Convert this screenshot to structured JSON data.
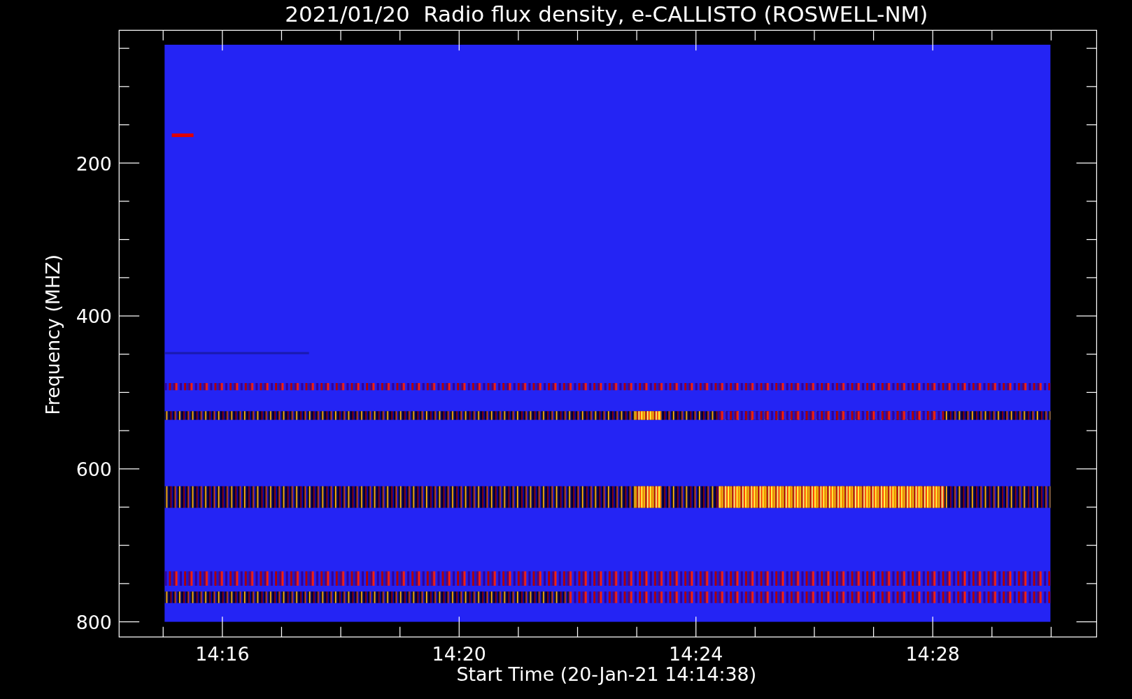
{
  "title": "2021/01/20  Radio flux density, e-CALLISTO (ROSWELL-NM)",
  "y_axis": {
    "label": "Frequency (MHZ)",
    "ticks": [
      "200",
      "400",
      "600",
      "800"
    ]
  },
  "x_axis": {
    "label": "Start Time (20-Jan-21 14:14:38)",
    "ticks": [
      "14:16",
      "14:20",
      "14:24",
      "14:28"
    ]
  }
}
